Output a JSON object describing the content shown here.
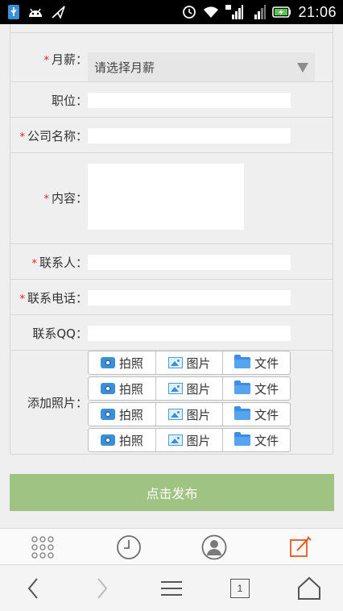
{
  "status_bar": {
    "time": "21:06"
  },
  "form": {
    "salary": {
      "label": "月薪：",
      "placeholder": "请选择月薪"
    },
    "position": {
      "label": "职位："
    },
    "company": {
      "label": "公司名称："
    },
    "content": {
      "label": "内容："
    },
    "contact": {
      "label": "联系人："
    },
    "phone": {
      "label": "联系电话："
    },
    "qq": {
      "label": "联系QQ："
    },
    "photos": {
      "label": "添加照片：",
      "buttons": {
        "camera": "拍照",
        "image": "图片",
        "file": "文件"
      }
    },
    "required_mark": "*"
  },
  "submit": {
    "label": "点击发布"
  },
  "toolbar": {
    "icons": [
      "apps-grid-icon",
      "history-clock-icon",
      "user-avatar-icon",
      "compose-edit-icon"
    ],
    "accent": "#e8581c"
  },
  "navbar": {
    "tabs_count": "1"
  },
  "colors": {
    "submit_bg": "#9fc382",
    "required": "#e02020"
  }
}
